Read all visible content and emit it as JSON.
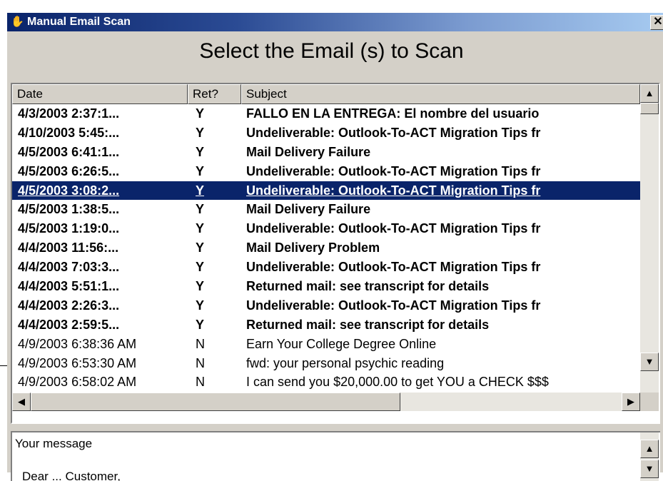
{
  "window": {
    "title": "Manual Email Scan",
    "close_label": "✕",
    "icon": "app-scan-icon"
  },
  "heading": "Select the Email (s) to Scan",
  "list": {
    "columns": [
      "Date",
      "Ret?",
      "Subject"
    ],
    "rows": [
      {
        "date": "4/3/2003 2:37:1...",
        "ret": "Y",
        "subject": "FALLO EN LA ENTREGA: El nombre del usuario",
        "bold": true,
        "selected": false
      },
      {
        "date": "4/10/2003 5:45:...",
        "ret": "Y",
        "subject": "Undeliverable: Outlook-To-ACT Migration Tips fr",
        "bold": true,
        "selected": false
      },
      {
        "date": "4/5/2003 6:41:1...",
        "ret": "Y",
        "subject": "Mail Delivery Failure",
        "bold": true,
        "selected": false
      },
      {
        "date": "4/5/2003 6:26:5...",
        "ret": "Y",
        "subject": "Undeliverable: Outlook-To-ACT Migration Tips fr",
        "bold": true,
        "selected": false
      },
      {
        "date": "4/5/2003 3:08:2...",
        "ret": "Y",
        "subject": "Undeliverable: Outlook-To-ACT Migration Tips fr",
        "bold": true,
        "selected": true
      },
      {
        "date": "4/5/2003 1:38:5...",
        "ret": "Y",
        "subject": "Mail Delivery Failure",
        "bold": true,
        "selected": false
      },
      {
        "date": "4/5/2003 1:19:0...",
        "ret": "Y",
        "subject": "Undeliverable: Outlook-To-ACT Migration Tips fr",
        "bold": true,
        "selected": false
      },
      {
        "date": "4/4/2003 11:56:...",
        "ret": "Y",
        "subject": "Mail Delivery Problem",
        "bold": true,
        "selected": false
      },
      {
        "date": "4/4/2003 7:03:3...",
        "ret": "Y",
        "subject": "Undeliverable: Outlook-To-ACT Migration Tips fr",
        "bold": true,
        "selected": false
      },
      {
        "date": "4/4/2003 5:51:1...",
        "ret": "Y",
        "subject": "Returned mail: see transcript for details",
        "bold": true,
        "selected": false
      },
      {
        "date": "4/4/2003 2:26:3...",
        "ret": "Y",
        "subject": "Undeliverable: Outlook-To-ACT Migration Tips fr",
        "bold": true,
        "selected": false
      },
      {
        "date": "4/4/2003 2:59:5...",
        "ret": "Y",
        "subject": "Returned mail: see transcript for details",
        "bold": true,
        "selected": false
      },
      {
        "date": "4/9/2003 6:38:36 AM",
        "ret": "N",
        "subject": "Earn Your College Degree Online",
        "bold": false,
        "selected": false
      },
      {
        "date": "4/9/2003 6:53:30 AM",
        "ret": "N",
        "subject": "fwd: your personal psychic reading",
        "bold": false,
        "selected": false
      },
      {
        "date": "4/9/2003 6:58:02 AM",
        "ret": "N",
        "subject": "I can send you $20,000.00 to get YOU a CHECK $$$",
        "bold": false,
        "selected": false
      }
    ]
  },
  "scroll": {
    "up_icon": "▲",
    "down_icon": "▼",
    "left_icon": "◀",
    "right_icon": "▶"
  },
  "message": {
    "label": "Your message",
    "line2": "Dear ... Customer,"
  }
}
